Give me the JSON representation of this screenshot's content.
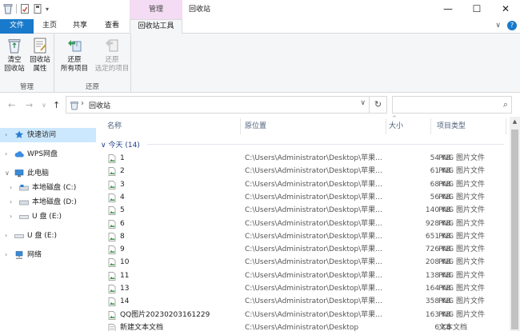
{
  "titlebar": {
    "context_tab_header": "管理",
    "title": "回收站",
    "minimize": "—",
    "maximize": "☐",
    "close": "✕"
  },
  "tabs": {
    "file": "文件",
    "home": "主页",
    "share": "共享",
    "view": "查看",
    "recycle_tools": "回收站工具",
    "collapse": "∨",
    "help": "?"
  },
  "ribbon": {
    "groups": [
      {
        "label": "管理",
        "buttons": [
          {
            "label_line1": "清空",
            "label_line2": "回收站",
            "enabled": true
          },
          {
            "label_line1": "回收站",
            "label_line2": "属性",
            "enabled": true
          }
        ]
      },
      {
        "label": "还原",
        "buttons": [
          {
            "label_line1": "还原",
            "label_line2": "所有项目",
            "enabled": true
          },
          {
            "label_line1": "还原",
            "label_line2": "选定的项目",
            "enabled": false
          }
        ]
      }
    ]
  },
  "address": {
    "back": "←",
    "forward": "→",
    "recent": "∨",
    "up": "↑",
    "separator": "›",
    "crumb": "回收站",
    "dropdown": "∨",
    "refresh": "↻",
    "search_placeholder": "",
    "search_icon": "⌕"
  },
  "nav": {
    "items": [
      {
        "label": "快速访问",
        "icon": "star-icon",
        "chev": "›",
        "selected": true
      },
      {
        "label": "WPS网盘",
        "icon": "cloud-icon",
        "chev": "›",
        "selected": false
      },
      {
        "label": "此电脑",
        "icon": "computer-icon",
        "chev": "∨",
        "selected": false
      },
      {
        "label": "本地磁盘 (C:)",
        "icon": "drive-icon",
        "chev": "›",
        "selected": false
      },
      {
        "label": "本地磁盘 (D:)",
        "icon": "drive-icon",
        "chev": "›",
        "selected": false
      },
      {
        "label": "U 盘 (E:)",
        "icon": "usb-drive-icon",
        "chev": "›",
        "selected": false
      },
      {
        "label": "U 盘 (E:)",
        "icon": "usb-drive-icon",
        "chev": "›",
        "selected": false
      },
      {
        "label": "网络",
        "icon": "network-icon",
        "chev": "›",
        "selected": false
      }
    ]
  },
  "list": {
    "columns": {
      "name": "名称",
      "location": "原位置",
      "size": "大小",
      "type": "项目类型",
      "sort_indicator": "^"
    },
    "group_label": "今天 (14)",
    "group_toggle": "∨",
    "rows": [
      {
        "name": "1",
        "location": "C:\\Users\\Administrator\\Desktop\\苹果...",
        "size": "54 KB",
        "type": "PNG 图片文件",
        "icon": "png-file-icon"
      },
      {
        "name": "2",
        "location": "C:\\Users\\Administrator\\Desktop\\苹果...",
        "size": "61 KB",
        "type": "PNG 图片文件",
        "icon": "png-file-icon"
      },
      {
        "name": "3",
        "location": "C:\\Users\\Administrator\\Desktop\\苹果...",
        "size": "68 KB",
        "type": "PNG 图片文件",
        "icon": "png-file-icon"
      },
      {
        "name": "4",
        "location": "C:\\Users\\Administrator\\Desktop\\苹果...",
        "size": "56 KB",
        "type": "PNG 图片文件",
        "icon": "png-file-icon"
      },
      {
        "name": "5",
        "location": "C:\\Users\\Administrator\\Desktop\\苹果...",
        "size": "140 KB",
        "type": "PNG 图片文件",
        "icon": "png-file-icon"
      },
      {
        "name": "6",
        "location": "C:\\Users\\Administrator\\Desktop\\苹果...",
        "size": "928 KB",
        "type": "PNG 图片文件",
        "icon": "png-file-icon"
      },
      {
        "name": "8",
        "location": "C:\\Users\\Administrator\\Desktop\\苹果...",
        "size": "651 KB",
        "type": "PNG 图片文件",
        "icon": "png-file-icon"
      },
      {
        "name": "9",
        "location": "C:\\Users\\Administrator\\Desktop\\苹果...",
        "size": "726 KB",
        "type": "PNG 图片文件",
        "icon": "png-file-icon"
      },
      {
        "name": "10",
        "location": "C:\\Users\\Administrator\\Desktop\\苹果...",
        "size": "208 KB",
        "type": "PNG 图片文件",
        "icon": "png-file-icon"
      },
      {
        "name": "11",
        "location": "C:\\Users\\Administrator\\Desktop\\苹果...",
        "size": "138 KB",
        "type": "PNG 图片文件",
        "icon": "png-file-icon"
      },
      {
        "name": "13",
        "location": "C:\\Users\\Administrator\\Desktop\\苹果...",
        "size": "164 KB",
        "type": "PNG 图片文件",
        "icon": "png-file-icon"
      },
      {
        "name": "14",
        "location": "C:\\Users\\Administrator\\Desktop\\苹果...",
        "size": "358 KB",
        "type": "PNG 图片文件",
        "icon": "png-file-icon"
      },
      {
        "name": "QQ图片20230203161229",
        "location": "C:\\Users\\Administrator\\Desktop\\苹果...",
        "size": "163 KB",
        "type": "PNG 图片文件",
        "icon": "png-file-icon"
      },
      {
        "name": "新建文本文档",
        "location": "C:\\Users\\Administrator\\Desktop",
        "size": "6 KB",
        "type": "文本文档",
        "icon": "text-file-icon"
      }
    ]
  },
  "scrollbar": {
    "up": "▲"
  },
  "colors": {
    "file_tab": "#1979ca",
    "context_tab": "#f3dcf4",
    "nav_selected": "#cce8ff",
    "group_label": "#1e3f8a"
  }
}
